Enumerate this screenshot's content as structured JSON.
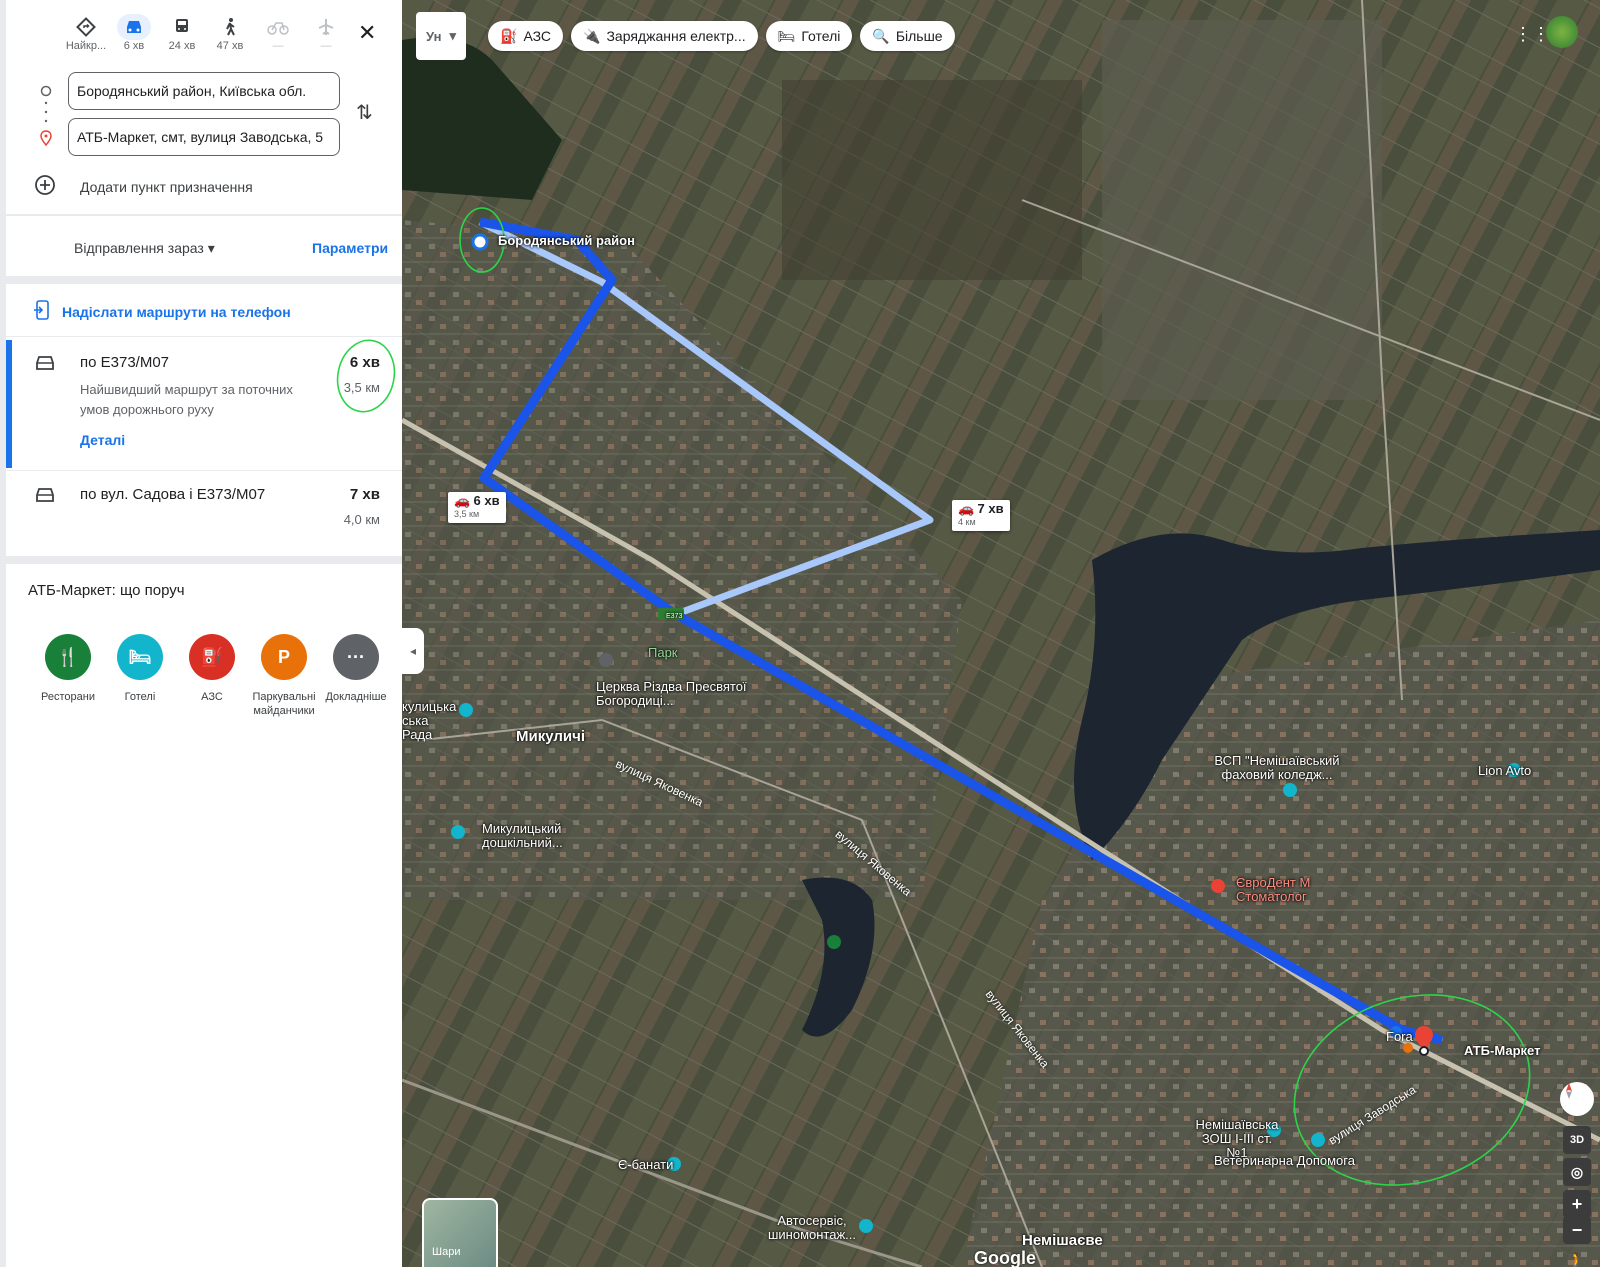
{
  "modes": [
    {
      "label": "Найкр...",
      "icon": "diamond-direction-icon"
    },
    {
      "label": "6 хв",
      "icon": "car-icon"
    },
    {
      "label": "24 хв",
      "icon": "train-icon"
    },
    {
      "label": "47 хв",
      "icon": "walk-icon"
    },
    {
      "label": "—",
      "icon": "bike-icon"
    },
    {
      "label": "—",
      "icon": "plane-icon"
    }
  ],
  "origin": "Бородянський район, Київська обл.",
  "destination": "АТБ-Маркет, смт, вулиця Заводська, 5",
  "add_destination": "Додати пункт призначення",
  "depart": "Відправлення зараз",
  "params": "Параметри",
  "send_to_phone": "Надіслати маршрути на телефон",
  "routes": [
    {
      "name": "по E373/M07",
      "time": "6 хв",
      "distance": "3,5 км",
      "desc": "Найшвидший маршрут за поточних умов дорожнього руху",
      "details": "Деталі"
    },
    {
      "name": "по вул. Садова і E373/M07",
      "time": "7 хв",
      "distance": "4,0 км"
    }
  ],
  "nearby_title": "АТБ-Маркет: що поруч",
  "nearby": [
    {
      "label": "Ресторани",
      "color": "#188038",
      "glyph": "🍴"
    },
    {
      "label": "Готелі",
      "color": "#12b5cb",
      "glyph": "🛏"
    },
    {
      "label": "АЗС",
      "color": "#d93025",
      "glyph": "⛽"
    },
    {
      "label": "Паркувальні майданчики",
      "color": "#e8710a",
      "glyph": "P"
    },
    {
      "label": "Докладніше",
      "color": "#5f6368",
      "glyph": "···"
    }
  ],
  "map": {
    "lang": "Ун",
    "chips": [
      "АЗС",
      "Заряджання електр...",
      "Готелі",
      "Більше"
    ],
    "origin_label": "Бородянський район",
    "dest_label": "АТБ-Маркет",
    "route_box_main": {
      "time": "6 хв",
      "dist": "3,5 км"
    },
    "route_box_alt": {
      "time": "7 хв",
      "dist": "4 км"
    },
    "labels": {
      "park": "Парк",
      "church": "Церква Різдва Пресвятої Богородиці...",
      "council": "кулицька ська Рада",
      "mykulychi": "Микуличі",
      "kindergarten": "Микулицький дошкільний...",
      "college": "ВСП \"Немішаївський фаховий коледж...",
      "lion": "Lion Avto",
      "dent": "ЄвроДент М Стоматолог",
      "fora": "Fora",
      "school": "Немішаївська ЗОШ I-III ст. №1",
      "vet": "Ветеринарна Допомога",
      "ebanaty": "Є-банати",
      "autoservice": "Автосервіс, шиномонтаж...",
      "nemishaeve": "Немішаєве",
      "google": "Google",
      "road": "E373"
    },
    "streets": {
      "yakovenka1": "вулиця Яковенка",
      "yakovenka2": "вулиця Яковенка",
      "yakovenka3": "вулиця Яковенка",
      "zavodska": "вулиця Заводська"
    },
    "layers": "Шари",
    "ctrl_3d": "3D"
  }
}
